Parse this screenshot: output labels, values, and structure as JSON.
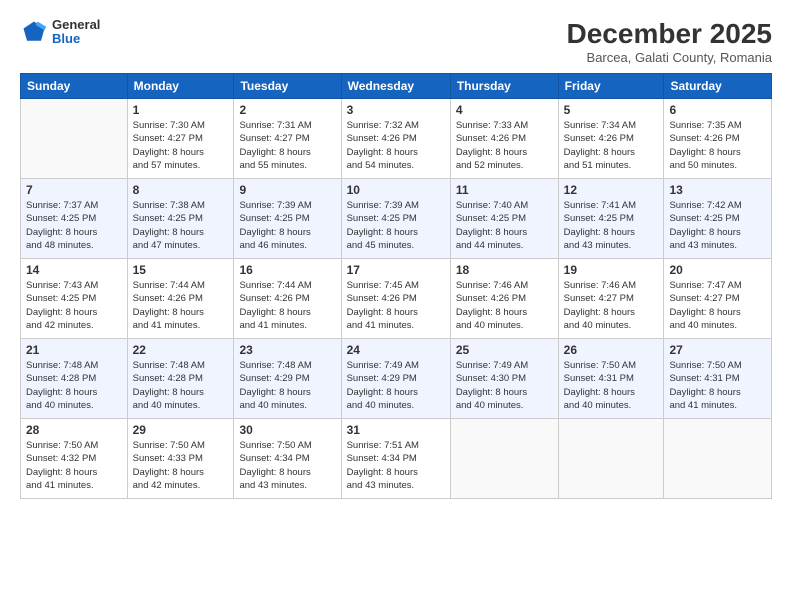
{
  "header": {
    "logo_general": "General",
    "logo_blue": "Blue",
    "month_year": "December 2025",
    "location": "Barcea, Galati County, Romania"
  },
  "weekdays": [
    "Sunday",
    "Monday",
    "Tuesday",
    "Wednesday",
    "Thursday",
    "Friday",
    "Saturday"
  ],
  "weeks": [
    [
      {
        "day": "",
        "sunrise": "",
        "sunset": "",
        "daylight": ""
      },
      {
        "day": "1",
        "sunrise": "Sunrise: 7:30 AM",
        "sunset": "Sunset: 4:27 PM",
        "daylight": "Daylight: 8 hours and 57 minutes."
      },
      {
        "day": "2",
        "sunrise": "Sunrise: 7:31 AM",
        "sunset": "Sunset: 4:27 PM",
        "daylight": "Daylight: 8 hours and 55 minutes."
      },
      {
        "day": "3",
        "sunrise": "Sunrise: 7:32 AM",
        "sunset": "Sunset: 4:26 PM",
        "daylight": "Daylight: 8 hours and 54 minutes."
      },
      {
        "day": "4",
        "sunrise": "Sunrise: 7:33 AM",
        "sunset": "Sunset: 4:26 PM",
        "daylight": "Daylight: 8 hours and 52 minutes."
      },
      {
        "day": "5",
        "sunrise": "Sunrise: 7:34 AM",
        "sunset": "Sunset: 4:26 PM",
        "daylight": "Daylight: 8 hours and 51 minutes."
      },
      {
        "day": "6",
        "sunrise": "Sunrise: 7:35 AM",
        "sunset": "Sunset: 4:26 PM",
        "daylight": "Daylight: 8 hours and 50 minutes."
      }
    ],
    [
      {
        "day": "7",
        "sunrise": "Sunrise: 7:37 AM",
        "sunset": "Sunset: 4:25 PM",
        "daylight": "Daylight: 8 hours and 48 minutes."
      },
      {
        "day": "8",
        "sunrise": "Sunrise: 7:38 AM",
        "sunset": "Sunset: 4:25 PM",
        "daylight": "Daylight: 8 hours and 47 minutes."
      },
      {
        "day": "9",
        "sunrise": "Sunrise: 7:39 AM",
        "sunset": "Sunset: 4:25 PM",
        "daylight": "Daylight: 8 hours and 46 minutes."
      },
      {
        "day": "10",
        "sunrise": "Sunrise: 7:39 AM",
        "sunset": "Sunset: 4:25 PM",
        "daylight": "Daylight: 8 hours and 45 minutes."
      },
      {
        "day": "11",
        "sunrise": "Sunrise: 7:40 AM",
        "sunset": "Sunset: 4:25 PM",
        "daylight": "Daylight: 8 hours and 44 minutes."
      },
      {
        "day": "12",
        "sunrise": "Sunrise: 7:41 AM",
        "sunset": "Sunset: 4:25 PM",
        "daylight": "Daylight: 8 hours and 43 minutes."
      },
      {
        "day": "13",
        "sunrise": "Sunrise: 7:42 AM",
        "sunset": "Sunset: 4:25 PM",
        "daylight": "Daylight: 8 hours and 43 minutes."
      }
    ],
    [
      {
        "day": "14",
        "sunrise": "Sunrise: 7:43 AM",
        "sunset": "Sunset: 4:25 PM",
        "daylight": "Daylight: 8 hours and 42 minutes."
      },
      {
        "day": "15",
        "sunrise": "Sunrise: 7:44 AM",
        "sunset": "Sunset: 4:26 PM",
        "daylight": "Daylight: 8 hours and 41 minutes."
      },
      {
        "day": "16",
        "sunrise": "Sunrise: 7:44 AM",
        "sunset": "Sunset: 4:26 PM",
        "daylight": "Daylight: 8 hours and 41 minutes."
      },
      {
        "day": "17",
        "sunrise": "Sunrise: 7:45 AM",
        "sunset": "Sunset: 4:26 PM",
        "daylight": "Daylight: 8 hours and 41 minutes."
      },
      {
        "day": "18",
        "sunrise": "Sunrise: 7:46 AM",
        "sunset": "Sunset: 4:26 PM",
        "daylight": "Daylight: 8 hours and 40 minutes."
      },
      {
        "day": "19",
        "sunrise": "Sunrise: 7:46 AM",
        "sunset": "Sunset: 4:27 PM",
        "daylight": "Daylight: 8 hours and 40 minutes."
      },
      {
        "day": "20",
        "sunrise": "Sunrise: 7:47 AM",
        "sunset": "Sunset: 4:27 PM",
        "daylight": "Daylight: 8 hours and 40 minutes."
      }
    ],
    [
      {
        "day": "21",
        "sunrise": "Sunrise: 7:48 AM",
        "sunset": "Sunset: 4:28 PM",
        "daylight": "Daylight: 8 hours and 40 minutes."
      },
      {
        "day": "22",
        "sunrise": "Sunrise: 7:48 AM",
        "sunset": "Sunset: 4:28 PM",
        "daylight": "Daylight: 8 hours and 40 minutes."
      },
      {
        "day": "23",
        "sunrise": "Sunrise: 7:48 AM",
        "sunset": "Sunset: 4:29 PM",
        "daylight": "Daylight: 8 hours and 40 minutes."
      },
      {
        "day": "24",
        "sunrise": "Sunrise: 7:49 AM",
        "sunset": "Sunset: 4:29 PM",
        "daylight": "Daylight: 8 hours and 40 minutes."
      },
      {
        "day": "25",
        "sunrise": "Sunrise: 7:49 AM",
        "sunset": "Sunset: 4:30 PM",
        "daylight": "Daylight: 8 hours and 40 minutes."
      },
      {
        "day": "26",
        "sunrise": "Sunrise: 7:50 AM",
        "sunset": "Sunset: 4:31 PM",
        "daylight": "Daylight: 8 hours and 40 minutes."
      },
      {
        "day": "27",
        "sunrise": "Sunrise: 7:50 AM",
        "sunset": "Sunset: 4:31 PM",
        "daylight": "Daylight: 8 hours and 41 minutes."
      }
    ],
    [
      {
        "day": "28",
        "sunrise": "Sunrise: 7:50 AM",
        "sunset": "Sunset: 4:32 PM",
        "daylight": "Daylight: 8 hours and 41 minutes."
      },
      {
        "day": "29",
        "sunrise": "Sunrise: 7:50 AM",
        "sunset": "Sunset: 4:33 PM",
        "daylight": "Daylight: 8 hours and 42 minutes."
      },
      {
        "day": "30",
        "sunrise": "Sunrise: 7:50 AM",
        "sunset": "Sunset: 4:34 PM",
        "daylight": "Daylight: 8 hours and 43 minutes."
      },
      {
        "day": "31",
        "sunrise": "Sunrise: 7:51 AM",
        "sunset": "Sunset: 4:34 PM",
        "daylight": "Daylight: 8 hours and 43 minutes."
      },
      {
        "day": "",
        "sunrise": "",
        "sunset": "",
        "daylight": ""
      },
      {
        "day": "",
        "sunrise": "",
        "sunset": "",
        "daylight": ""
      },
      {
        "day": "",
        "sunrise": "",
        "sunset": "",
        "daylight": ""
      }
    ]
  ]
}
